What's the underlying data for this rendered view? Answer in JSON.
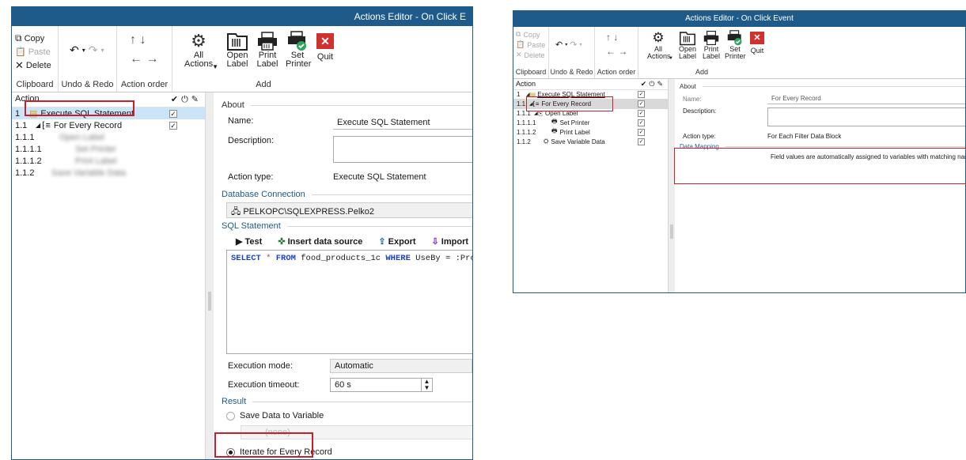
{
  "left": {
    "title": "Actions Editor - On Click E",
    "clipboard": {
      "copy": "Copy",
      "paste": "Paste",
      "delete": "Delete",
      "group": "Clipboard"
    },
    "undo": {
      "group": "Undo & Redo"
    },
    "order": {
      "group": "Action order"
    },
    "all_actions": "All Actions",
    "add_group": "Add",
    "buttons": {
      "open": "Open Label",
      "print": "Print Label",
      "set": "Set Printer",
      "quit": "Quit"
    },
    "tree": {
      "header": "Action",
      "rows": [
        {
          "num": "1",
          "label": "Execute SQL Statement",
          "checked": true
        },
        {
          "num": "1.1",
          "label": "For Every Record",
          "checked": true
        },
        {
          "num": "1.1.1",
          "label": "Open Label",
          "checked": true
        },
        {
          "num": "1.1.1.1",
          "label": "Set Printer",
          "checked": true
        },
        {
          "num": "1.1.1.2",
          "label": "Print Label",
          "checked": true
        },
        {
          "num": "1.1.2",
          "label": "Save Variable Data",
          "checked": true
        }
      ]
    },
    "about": {
      "section": "About",
      "name_label": "Name:",
      "name_value": "Execute SQL Statement",
      "desc_label": "Description:",
      "type_label": "Action type:",
      "type_value": "Execute SQL Statement"
    },
    "db": {
      "section": "Database Connection",
      "value": "PELKOPC\\SQLEXPRESS.Pelko2"
    },
    "sql": {
      "section": "SQL Statement",
      "test": "Test",
      "insert": "Insert data source",
      "export": "Export",
      "import": "Import",
      "kw1": "SELECT",
      "star": " * ",
      "kw2": "FROM",
      "table": " food_products_1c ",
      "kw3": "WHERE",
      "cond": " UseBy = :Prod"
    },
    "exec": {
      "mode_label": "Execution mode:",
      "mode_value": "Automatic",
      "timeout_label": "Execution timeout:",
      "timeout_value": "60 s"
    },
    "result": {
      "section": "Result",
      "opt1": "Save Data to Variable",
      "none": "(none)",
      "opt2": "Iterate for Every Record"
    }
  },
  "right": {
    "title": "Actions Editor - On Click Event",
    "clipboard": {
      "copy": "Copy",
      "paste": "Paste",
      "delete": "Delete",
      "group": "Clipboard"
    },
    "undo": {
      "group": "Undo & Redo"
    },
    "order": {
      "group": "Action order"
    },
    "all_actions": "All Actions",
    "add_group": "Add",
    "buttons": {
      "open": "Open Label",
      "print": "Print Label",
      "set": "Set Printer",
      "quit": "Quit"
    },
    "tree": {
      "header": "Action",
      "rows": [
        {
          "num": "1",
          "label": "Execute SQL Statement",
          "checked": true
        },
        {
          "num": "1.1",
          "label": "For Every Record",
          "checked": true
        },
        {
          "num": "1.1.1",
          "label": "Open Label",
          "checked": true
        },
        {
          "num": "1.1.1.1",
          "label": "Set Printer",
          "checked": true
        },
        {
          "num": "1.1.1.2",
          "label": "Print Label",
          "checked": true
        },
        {
          "num": "1.1.2",
          "label": "Save Variable Data",
          "checked": true
        }
      ]
    },
    "about": {
      "section": "About",
      "name_label": "Name:",
      "name_value": "For Every Record",
      "desc_label": "Description:",
      "type_label": "Action type:",
      "type_value": "For Each Filter Data Block"
    },
    "mapping": {
      "section": "Data Mapping",
      "text": "Field values are automatically assigned to variables with matching name"
    }
  }
}
